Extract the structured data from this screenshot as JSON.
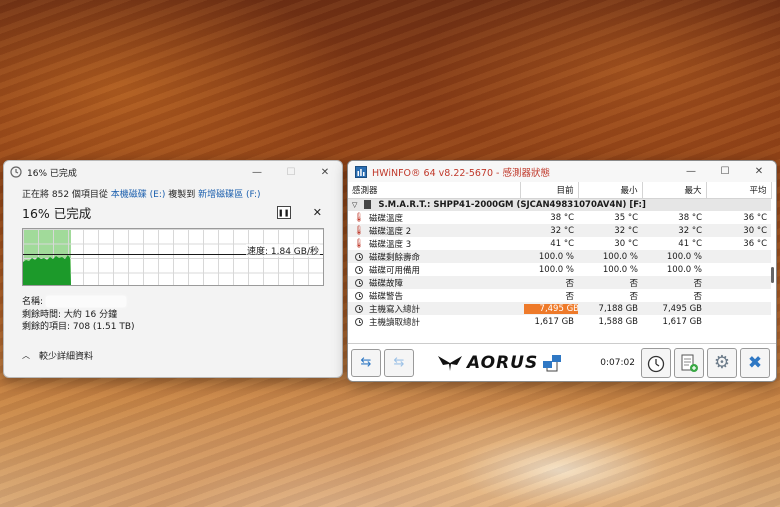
{
  "copy_dialog": {
    "title": "16% 已完成",
    "status_prefix": "正在將 852 個項目從",
    "source": "本機磁碟 (E:)",
    "status_mid": "複製到",
    "destination": "新增磁碟區 (F:)",
    "percent": "16% 已完成",
    "progress_fraction": 0.16,
    "speed": "速度: 1.84 GB/秒",
    "name_label": "名稱:",
    "time_remaining": "剩餘時間: 大約 16 分鐘",
    "items_remaining": "剩餘的項目: 708 (1.51 TB)",
    "details_toggle": "較少詳細資料"
  },
  "hwinfo": {
    "title": "HWiNFO® 64 v8.22-5670 - 感測器狀態",
    "columns": [
      "感測器",
      "目前",
      "最小",
      "最大",
      "平均"
    ],
    "group": "S.M.A.R.T.: SHPP41-2000GM (SJCAN49831070AV4N) [F:]",
    "rows": [
      {
        "icon": "thermometer-icon",
        "name": "磁碟溫度",
        "cur": "38 °C",
        "min": "35 °C",
        "max": "38 °C",
        "avg": "36 °C"
      },
      {
        "icon": "thermometer-icon",
        "name": "磁碟溫度 2",
        "cur": "32 °C",
        "min": "32 °C",
        "max": "32 °C",
        "avg": "30 °C"
      },
      {
        "icon": "thermometer-icon",
        "name": "磁碟溫度 3",
        "cur": "41 °C",
        "min": "30 °C",
        "max": "41 °C",
        "avg": "36 °C"
      },
      {
        "icon": "clock-icon",
        "name": "磁碟剩餘壽命",
        "cur": "100.0 %",
        "min": "100.0 %",
        "max": "100.0 %",
        "avg": ""
      },
      {
        "icon": "clock-icon",
        "name": "磁碟可用備用",
        "cur": "100.0 %",
        "min": "100.0 %",
        "max": "100.0 %",
        "avg": ""
      },
      {
        "icon": "clock-icon",
        "name": "磁碟故障",
        "cur": "否",
        "min": "否",
        "max": "否",
        "avg": ""
      },
      {
        "icon": "clock-icon",
        "name": "磁碟警告",
        "cur": "否",
        "min": "否",
        "max": "否",
        "avg": ""
      },
      {
        "icon": "clock-icon",
        "name": "主機寫入總計",
        "cur": "7,495 GB",
        "min": "7,188 GB",
        "max": "7,495 GB",
        "avg": "",
        "highlight": true
      },
      {
        "icon": "clock-icon",
        "name": "主機讀取總計",
        "cur": "1,617 GB",
        "min": "1,588 GB",
        "max": "1,617 GB",
        "avg": ""
      }
    ],
    "brand": "AORUS",
    "timer": "0:07:02",
    "highlight_color": "#ee7a2a"
  }
}
